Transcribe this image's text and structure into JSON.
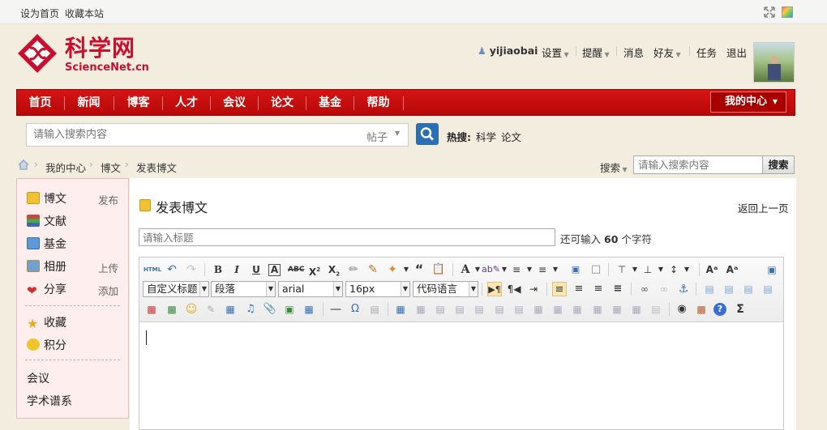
{
  "topbar": {
    "set_home": "设为首页",
    "bookmark": "收藏本站"
  },
  "logo": {
    "name": "科学网",
    "domain": "ScienceNet.cn"
  },
  "usernav": {
    "username": "yijiaobai",
    "items": [
      "设置",
      "提醒",
      "消息",
      "好友",
      "任务",
      "退出"
    ]
  },
  "mainnav": {
    "items": [
      "首页",
      "新闻",
      "博客",
      "人才",
      "会议",
      "论文",
      "基金",
      "帮助"
    ],
    "my_center": "我的中心"
  },
  "search": {
    "placeholder": "请输入搜索内容",
    "type": "帖子",
    "hot_label": "热搜:",
    "hot_items": [
      "科学",
      "论文"
    ]
  },
  "breadcrumb": [
    "我的中心",
    "博文",
    "发表博文"
  ],
  "right_search": {
    "label": "搜索",
    "placeholder": "请输入搜索内容",
    "button": "搜索"
  },
  "sidebar": {
    "items": [
      {
        "label": "博文",
        "aux": "发布",
        "icon": "blog-icon"
      },
      {
        "label": "文献",
        "aux": "",
        "icon": "books-icon"
      },
      {
        "label": "基金",
        "aux": "",
        "icon": "user-card-icon"
      },
      {
        "label": "相册",
        "aux": "上传",
        "icon": "photo-icon"
      },
      {
        "label": "分享",
        "aux": "添加",
        "icon": "share-heart-icon"
      },
      {
        "label": "收藏",
        "aux": "",
        "icon": "star-icon"
      },
      {
        "label": "积分",
        "aux": "",
        "icon": "points-icon"
      },
      {
        "label": "会议",
        "aux": ""
      },
      {
        "label": "学术谱系",
        "aux": ""
      }
    ]
  },
  "main": {
    "title": "发表博文",
    "back": "返回上一页",
    "title_placeholder": "请输入标题",
    "remain_prefix": "还可输入",
    "remain_count": "60",
    "remain_suffix": "个字符"
  },
  "editor": {
    "html_label": "HTML",
    "selects": [
      "自定义标题",
      "段落",
      "arial",
      "16px",
      "代码语言"
    ]
  }
}
